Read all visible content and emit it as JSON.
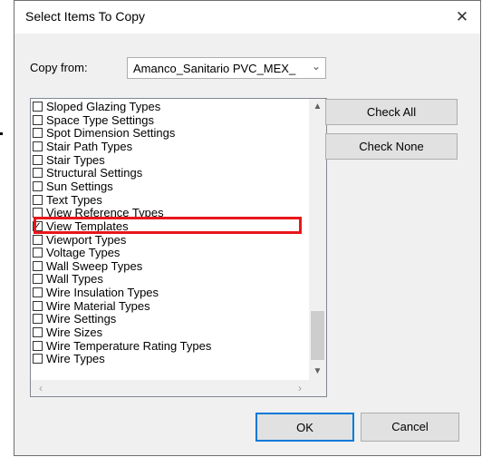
{
  "dialog": {
    "title": "Select Items To Copy",
    "close_glyph": "✕"
  },
  "copy_from": {
    "label": "Copy from:",
    "value": "Amanco_Sanitario PVC_MEX_"
  },
  "list": {
    "items": [
      {
        "label": "Sloped Glazing Types",
        "checked": false
      },
      {
        "label": "Space Type Settings",
        "checked": false
      },
      {
        "label": "Spot Dimension Settings",
        "checked": false
      },
      {
        "label": "Stair Path Types",
        "checked": false
      },
      {
        "label": "Stair Types",
        "checked": false
      },
      {
        "label": "Structural Settings",
        "checked": false
      },
      {
        "label": "Sun Settings",
        "checked": false
      },
      {
        "label": "Text Types",
        "checked": false
      },
      {
        "label": "View Reference Types",
        "checked": false
      },
      {
        "label": "View Templates",
        "checked": true
      },
      {
        "label": "Viewport Types",
        "checked": false
      },
      {
        "label": "Voltage Types",
        "checked": false
      },
      {
        "label": "Wall Sweep Types",
        "checked": false
      },
      {
        "label": "Wall Types",
        "checked": false
      },
      {
        "label": "Wire Insulation Types",
        "checked": false
      },
      {
        "label": "Wire Material Types",
        "checked": false
      },
      {
        "label": "Wire Settings",
        "checked": false
      },
      {
        "label": "Wire Sizes",
        "checked": false
      },
      {
        "label": "Wire Temperature Rating Types",
        "checked": false
      },
      {
        "label": "Wire Types",
        "checked": false
      }
    ]
  },
  "buttons": {
    "check_all": "Check All",
    "check_none": "Check None",
    "ok": "OK",
    "cancel": "Cancel"
  },
  "colors": {
    "highlight": "#e8161a",
    "default_button_border": "#0078d7"
  }
}
